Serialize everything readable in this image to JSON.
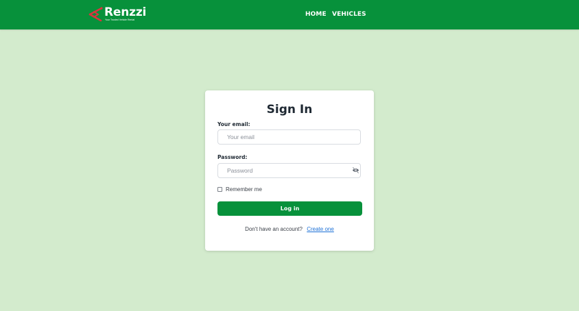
{
  "nav": {
    "brand": "Renzzi",
    "tagline": "Your Trusted Vehicle Rental",
    "links": [
      {
        "label": "HOME"
      },
      {
        "label": "VEHICLES"
      }
    ]
  },
  "login": {
    "title": "Sign In",
    "email_label": "Your email:",
    "email_placeholder": "Your email",
    "email_value": "",
    "password_label": "Password:",
    "password_placeholder": "Password",
    "password_value": "",
    "remember_label": "Remember me",
    "remember_checked": false,
    "submit_label": "Log in",
    "signup_prompt": "Don't have an account?",
    "signup_link": "Create one"
  },
  "icons": {
    "brand_mark": "arrow-logo-icon",
    "password_toggle": "eye-slash-icon",
    "remember": "checkbox-icon"
  },
  "colors": {
    "primary_green": "#07913b",
    "page_background": "#d3ebcd",
    "logo_accent": "#d8343e",
    "link_blue": "#1a6fd6"
  }
}
